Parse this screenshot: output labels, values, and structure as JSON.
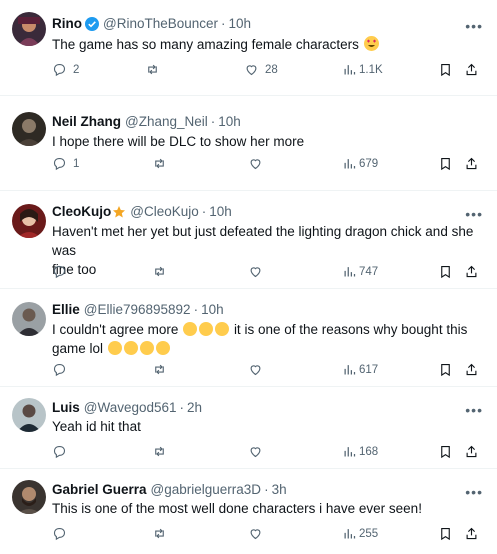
{
  "tweets": [
    {
      "name": "Rino",
      "handle": "@RinoTheBouncer",
      "time": "10h",
      "text": "The game has so many amazing female characters",
      "text2": "",
      "replies": "2",
      "retweets": "",
      "likes": "28",
      "views": "1.1K",
      "verified": true
    },
    {
      "name": "Neil Zhang",
      "handle": "@Zhang_Neil",
      "time": "10h",
      "text": "I hope there will be DLC to show her more",
      "text2": "",
      "replies": "1",
      "retweets": "",
      "likes": "",
      "views": "679"
    },
    {
      "name": "CleoKujo",
      "handle": "@CleoKujo",
      "time": "10h",
      "text": "Haven't met her yet but just defeated the lighting dragon chick and she was",
      "text2": "fine too",
      "replies": "",
      "retweets": "",
      "likes": "",
      "views": "747"
    },
    {
      "name": "Ellie",
      "handle": "@Ellie796895892",
      "time": "10h",
      "text": "I couldn't agree more",
      "text_after": "it is one of the reasons why bought this",
      "text2": "game lol",
      "replies": "",
      "retweets": "",
      "likes": "",
      "views": "617"
    },
    {
      "name": "Luis",
      "handle": "@Wavegod561",
      "time": "2h",
      "text": "Yeah id hit that",
      "text2": "",
      "replies": "",
      "retweets": "",
      "likes": "",
      "views": "168"
    },
    {
      "name": "Gabriel Guerra",
      "handle": "@gabrielguerra3D",
      "time": "3h",
      "text": "This is one of the most well done characters i have ever seen!",
      "text2": "",
      "replies": "",
      "retweets": "",
      "likes": "",
      "views": "255"
    }
  ],
  "icons": {
    "reply": "reply-icon",
    "retweet": "retweet-icon",
    "like": "heart-icon",
    "views": "views-icon",
    "bookmark": "bookmark-icon",
    "share": "share-icon",
    "more": "more-icon"
  },
  "colors": {
    "verified": "#1d9bf0",
    "gold_star": "#f4a623",
    "text_secondary": "#536471"
  }
}
